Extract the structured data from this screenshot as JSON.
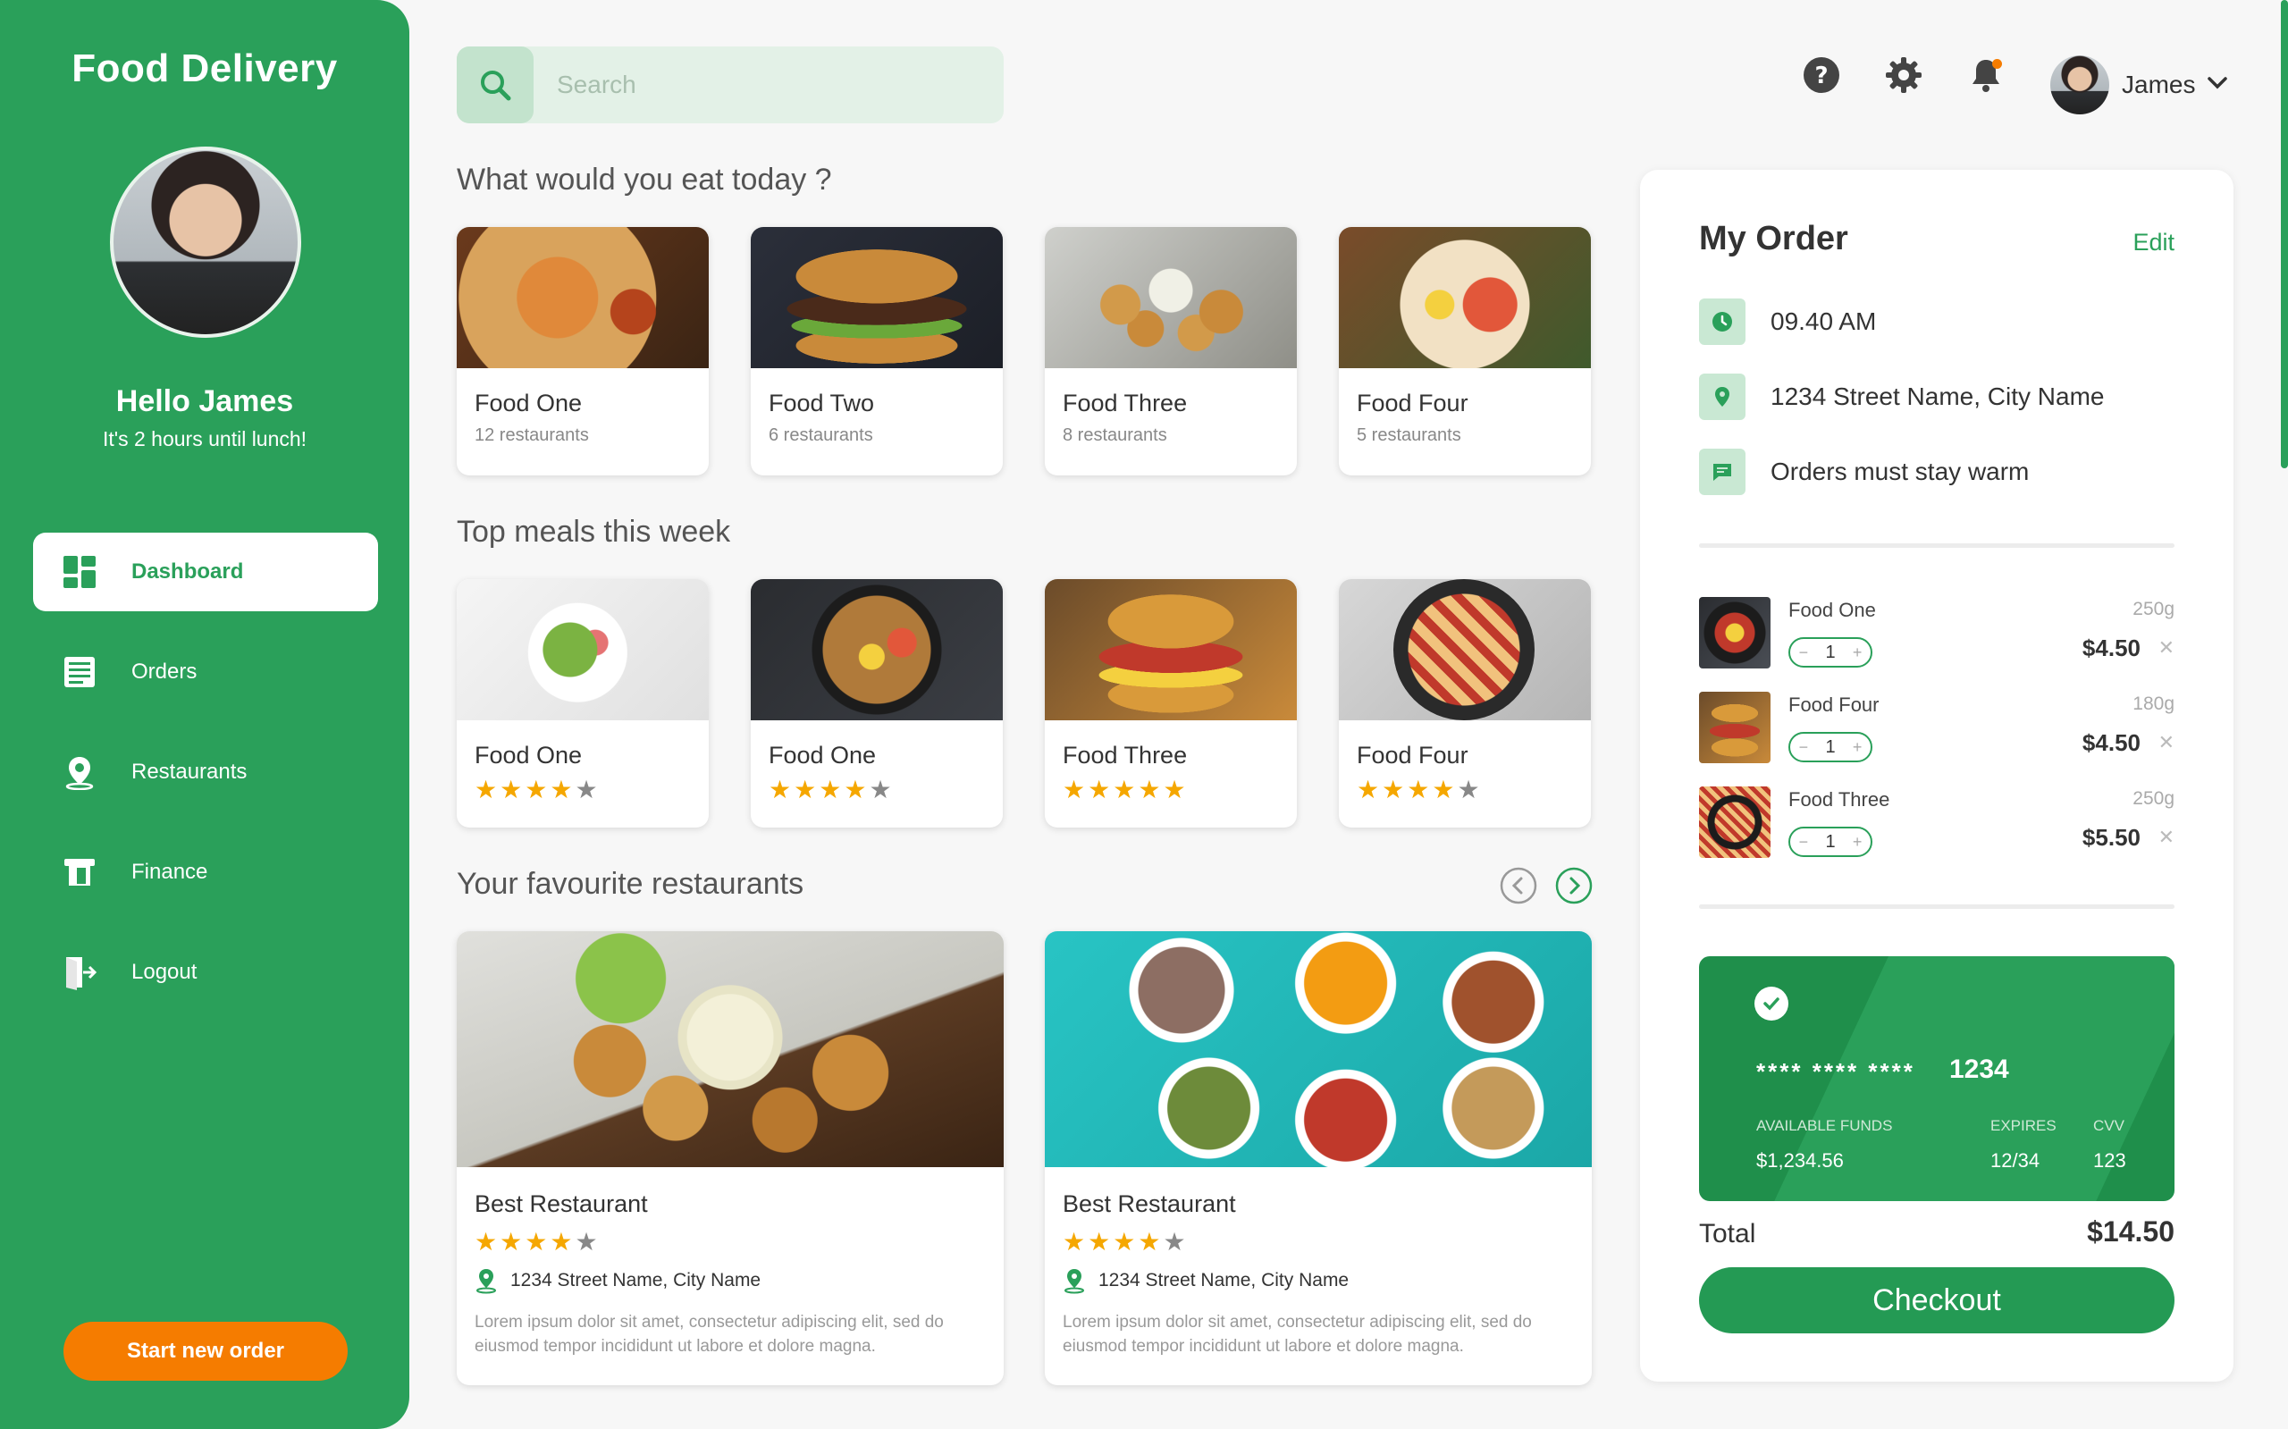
{
  "sidebar": {
    "brand": "Food Delivery",
    "greeting": "Hello James",
    "subtitle": "It's 2 hours until lunch!",
    "nav": [
      {
        "label": "Dashboard",
        "icon": "dashboard-icon",
        "active": true
      },
      {
        "label": "Orders",
        "icon": "orders-icon",
        "active": false
      },
      {
        "label": "Restaurants",
        "icon": "location-pin-icon",
        "active": false
      },
      {
        "label": "Finance",
        "icon": "finance-icon",
        "active": false
      },
      {
        "label": "Logout",
        "icon": "logout-icon",
        "active": false
      }
    ],
    "start_button": "Start new order"
  },
  "header": {
    "search_placeholder": "Search",
    "icons": [
      "help-icon",
      "settings-gear-icon",
      "notification-bell-icon"
    ],
    "user_name": "James"
  },
  "categories": {
    "title": "What would you eat today ?",
    "items": [
      {
        "name": "Food One",
        "sub": "12 restaurants"
      },
      {
        "name": "Food Two",
        "sub": "6 restaurants"
      },
      {
        "name": "Food Three",
        "sub": "8 restaurants"
      },
      {
        "name": "Food Four",
        "sub": "5 restaurants"
      }
    ]
  },
  "top_meals": {
    "title": "Top meals this week",
    "items": [
      {
        "name": "Food One",
        "rating": 4
      },
      {
        "name": "Food One",
        "rating": 4
      },
      {
        "name": "Food Three",
        "rating": 5
      },
      {
        "name": "Food Four",
        "rating": 4
      }
    ]
  },
  "favourites": {
    "title": "Your favourite restaurants",
    "items": [
      {
        "name": "Best Restaurant",
        "rating": 4,
        "address": "1234 Street Name, City Name",
        "description": "Lorem ipsum dolor sit amet, consectetur adipiscing elit, sed do eiusmod tempor incididunt ut labore et dolore magna."
      },
      {
        "name": "Best Restaurant",
        "rating": 4,
        "address": "1234 Street Name, City Name",
        "description": "Lorem ipsum dolor sit amet, consectetur adipiscing elit, sed do eiusmod tempor incididunt ut labore et dolore magna."
      }
    ]
  },
  "order": {
    "title": "My Order",
    "edit": "Edit",
    "time": "09.40 AM",
    "address": "1234 Street Name, City Name",
    "note": "Orders must stay warm",
    "items": [
      {
        "name": "Food One",
        "weight": "250g",
        "qty": "1",
        "price": "$4.50"
      },
      {
        "name": "Food Four",
        "weight": "180g",
        "qty": "1",
        "price": "$4.50"
      },
      {
        "name": "Food Three",
        "weight": "250g",
        "qty": "1",
        "price": "$5.50"
      }
    ],
    "card": {
      "masked": "**** **** ****",
      "last4": "1234",
      "funds_label": "AVAILABLE FUNDS",
      "funds": "$1,234.56",
      "expires_label": "EXPIRES",
      "expires": "12/34",
      "cvv_label": "CVV",
      "cvv": "123"
    },
    "total_label": "Total",
    "total": "$14.50",
    "checkout": "Checkout"
  },
  "colors": {
    "brand_green": "#2aa05a",
    "accent_orange": "#f57c00",
    "star": "#f5a700"
  }
}
